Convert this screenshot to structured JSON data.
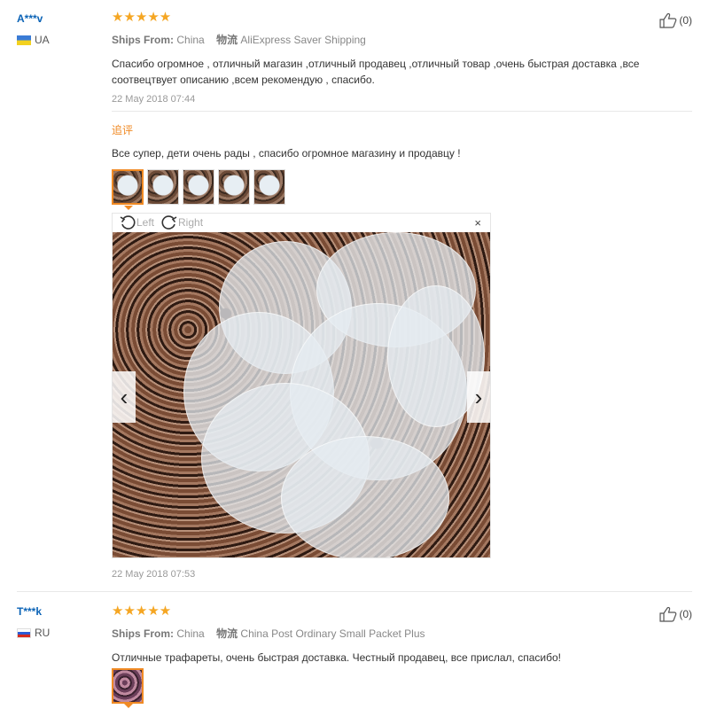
{
  "reviews": [
    {
      "user": "A***v",
      "country": "UA",
      "stars": "★★★★★",
      "ships_from_label": "Ships From:",
      "ships_from": "China",
      "logistics_label": "物流",
      "logistics": "AliExpress Saver Shipping",
      "text": "Спасибо огромное , отличный магазин ,отличный продавец ,отличный товар ,очень быстрая доставка ,все соотвецтвует описанию ,всем рекомендую , спасибо.",
      "date": "22 May 2018 07:44",
      "helpful": "(0)",
      "followup": {
        "label": "追评",
        "text": "Все супер, дети очень рады , спасибо огромное магазину и продавцу !",
        "photo_count": 5,
        "viewer": {
          "rotate_left": "Left",
          "rotate_right": "Right",
          "close": "×",
          "prev": "‹",
          "next": "›"
        },
        "date": "22 May 2018 07:53"
      }
    },
    {
      "user": "T***k",
      "country": "RU",
      "stars": "★★★★★",
      "ships_from_label": "Ships From:",
      "ships_from": "China",
      "logistics_label": "物流",
      "logistics": "China Post Ordinary Small Packet Plus",
      "text": "Отличные трафареты, очень быстрая доставка. Честный продавец, все прислал, спасибо!",
      "helpful": "(0)"
    }
  ],
  "colors": {
    "star": "#f5a623",
    "username": "#0b63b6",
    "followup_label": "#f08a24"
  }
}
